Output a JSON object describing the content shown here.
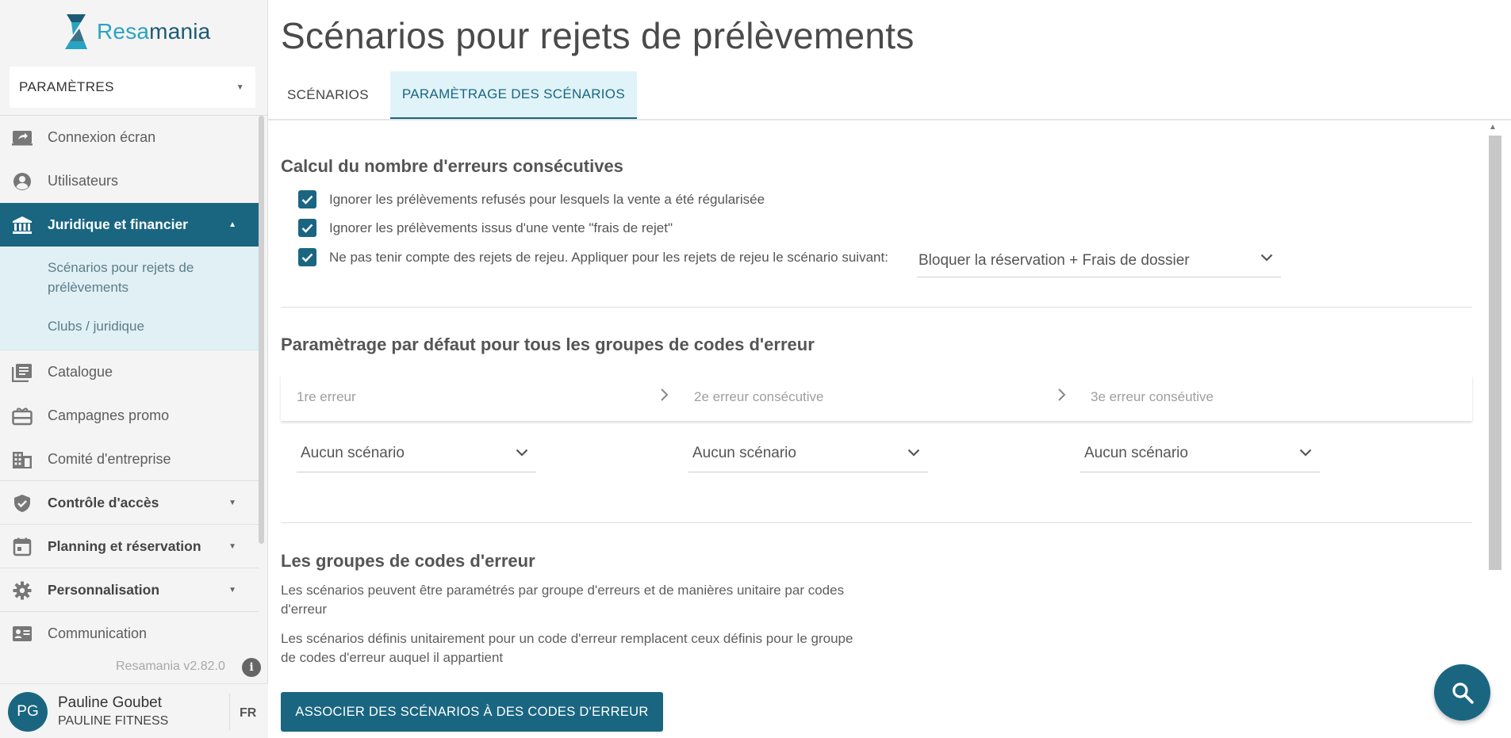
{
  "app": {
    "logo_part1": "Resa",
    "logo_part2": "mania",
    "version": "Resamania v2.82.0",
    "info_glyph": "i"
  },
  "sidebar": {
    "section_select": "PARAMÈTRES",
    "items": [
      {
        "label": "Connexion écran",
        "icon": "screen-share-icon"
      },
      {
        "label": "Utilisateurs",
        "icon": "user-circle-icon"
      },
      {
        "label": "Juridique et financier",
        "icon": "bank-icon",
        "active": true
      },
      {
        "label": "Catalogue",
        "icon": "catalog-icon"
      },
      {
        "label": "Campagnes promo",
        "icon": "gift-card-icon"
      },
      {
        "label": "Comité d'entreprise",
        "icon": "building-icon"
      },
      {
        "label": "Contrôle d'accès",
        "icon": "shield-check-icon"
      },
      {
        "label": "Planning et réservation",
        "icon": "calendar-icon"
      },
      {
        "label": "Personnalisation",
        "icon": "gear-icon"
      },
      {
        "label": "Communication",
        "icon": "contact-card-icon"
      }
    ],
    "subitems": [
      {
        "label_line1": "Scénarios pour rejets de",
        "label_line2": "prélèvements"
      },
      {
        "label": "Clubs / juridique"
      }
    ]
  },
  "user": {
    "initials": "PG",
    "name": "Pauline Goubet",
    "company": "PAULINE FITNESS",
    "language": "FR"
  },
  "page": {
    "title": "Scénarios pour rejets de prélèvements",
    "tabs": [
      {
        "label": "SCÉNARIOS",
        "active": false
      },
      {
        "label": "PARAMÈTRAGE DES SCÉNARIOS",
        "active": true
      }
    ]
  },
  "section1": {
    "title": "Calcul du nombre d'erreurs consécutives",
    "checkboxes": [
      {
        "label": "Ignorer les prélèvements refusés pour lesquels la vente a été régularisée",
        "checked": true
      },
      {
        "label": "Ignorer les prélèvements issus d'une vente \"frais de rejet\"",
        "checked": true
      },
      {
        "label": "Ne pas tenir compte des rejets de rejeu. Appliquer pour les rejets de rejeu le scénario suivant:",
        "checked": true
      }
    ],
    "replay_scenario": "Bloquer la réservation + Frais de dossier"
  },
  "section2": {
    "title": "Paramètrage par défaut pour tous les groupes de codes d'erreur",
    "steps": [
      "1re erreur",
      "2e erreur consécutive",
      "3e erreur conséutive"
    ],
    "selects": [
      "Aucun scénario",
      "Aucun scénario",
      "Aucun scénario"
    ]
  },
  "section3": {
    "title": "Les groupes de codes d'erreur",
    "desc1_line1": "Les scénarios peuvent être paramétrés par groupe d'erreurs et de manières unitaire par codes",
    "desc1_line2": "d'erreur",
    "desc2_line1": "Les scénarios définis unitairement pour un code d'erreur remplacent ceux définis pour le groupe",
    "desc2_line2": "de codes d'erreur auquel il appartient",
    "button": "ASSOCIER DES SCÉNARIOS À DES CODES D'ERREUR"
  },
  "colors": {
    "primary": "#1a6681",
    "accent": "#29a3c2",
    "active_tab_bg": "#e0f3f8",
    "submenu_bg": "#e0f0f5"
  }
}
